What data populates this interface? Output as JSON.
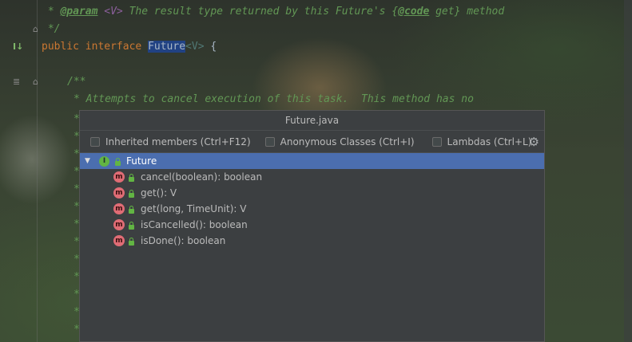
{
  "editor": {
    "line1_prefix": " * ",
    "line1_tag": "@param",
    "line1_generic": " <V>",
    "line1_text": " The result type returned by this Future's {",
    "line1_code_tag": "@code",
    "line1_rest": " get} method",
    "line2": " */",
    "line3_kw1": "public",
    "line3_kw2": "interface",
    "line3_name": "Future",
    "line3_generic": "<V>",
    "line3_brace": " {",
    "line4": "/**",
    "line5": "* Attempts to cancel execution of this task.  This method has no",
    "star": "*"
  },
  "popup": {
    "title": "Future.java",
    "filters": [
      {
        "label": "Inherited members (Ctrl+F12)",
        "checked": false
      },
      {
        "label": "Anonymous Classes (Ctrl+I)",
        "checked": false
      },
      {
        "label": "Lambdas (Ctrl+L)",
        "checked": false
      }
    ],
    "settings_icon": "gear-icon",
    "root": {
      "label": "Future",
      "icon": "interface-icon",
      "icon_letter": "I"
    },
    "members": [
      {
        "label": "cancel(boolean): boolean",
        "icon_letter": "m"
      },
      {
        "label": "get(): V",
        "icon_letter": "m"
      },
      {
        "label": "get(long, TimeUnit): V",
        "icon_letter": "m"
      },
      {
        "label": "isCancelled(): boolean",
        "icon_letter": "m"
      },
      {
        "label": "isDone(): boolean",
        "icon_letter": "m"
      }
    ]
  }
}
